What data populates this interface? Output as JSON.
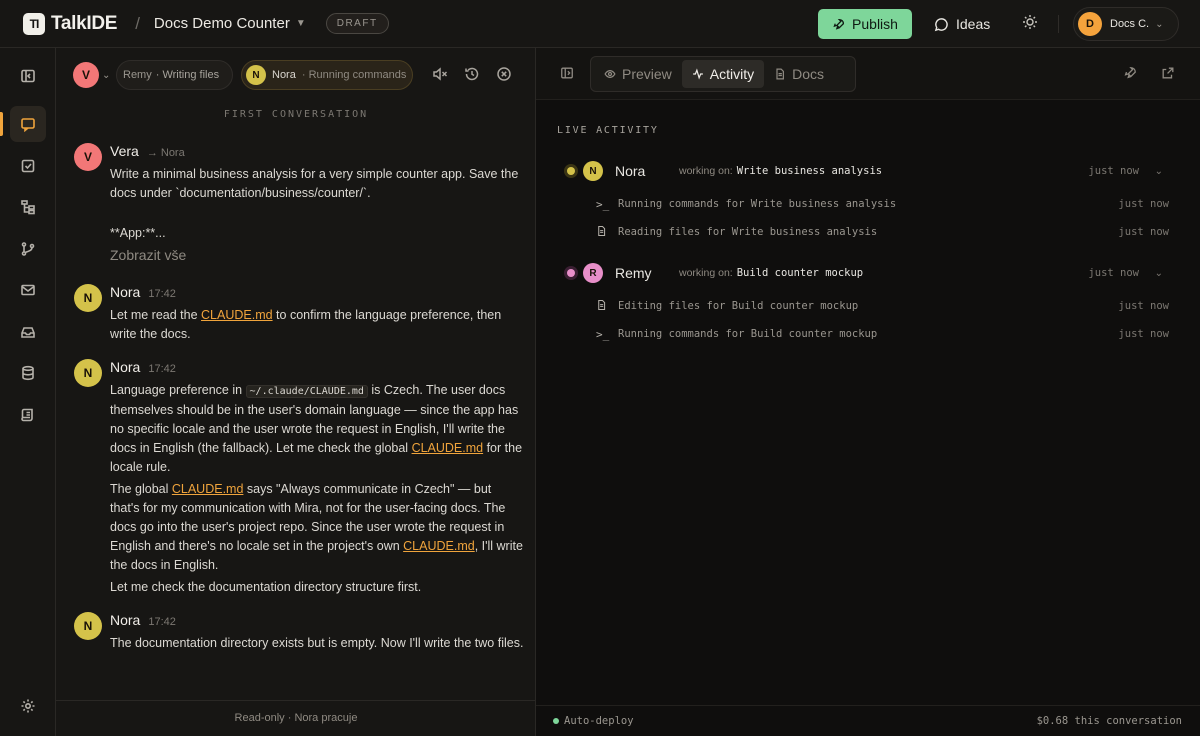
{
  "app": {
    "name": "TalkIDE",
    "logo_mark": "TI",
    "crumb_separator": "/",
    "project_name": "Docs Demo Counter",
    "status_badge": "DRAFT"
  },
  "header": {
    "publish_label": "Publish",
    "ideas_label": "Ideas",
    "user": {
      "initial": "D",
      "name": "Docs C.",
      "color": "#f5a33c"
    }
  },
  "chat": {
    "selected_user_initial": "V",
    "agents": [
      {
        "name": "Remy",
        "status": "· Writing files"
      },
      {
        "name": "Nora",
        "initial": "N",
        "status": "· Running commands"
      }
    ],
    "conversation_label": "FIRST CONVERSATION",
    "messages": [
      {
        "initial": "V",
        "author": "Vera",
        "to": "Nora",
        "text": "Write a minimal business analysis for a very simple counter app. Save the docs under `documentation/business/counter/`.",
        "text2": "**App:**...",
        "show_more": "Zobrazit vše"
      },
      {
        "initial": "N",
        "author": "Nora",
        "time": "17:42",
        "p1_a": "Let me read the ",
        "p1_link": "CLAUDE.md",
        "p1_b": " to confirm the language preference, then write the docs."
      },
      {
        "initial": "N",
        "author": "Nora",
        "time": "17:42",
        "p1_a": "Language preference in ",
        "p1_code": "~/.claude/CLAUDE.md",
        "p1_b": " is Czech. The user docs themselves should be in the user's domain language — since the app has no specific locale and the user wrote the request in English, I'll write the docs in English (the fallback). Let me check the global ",
        "p1_link": "CLAUDE.md",
        "p1_c": " for the locale rule.",
        "p2_a": "The global ",
        "p2_link": "CLAUDE.md",
        "p2_b": " says \"Always communicate in Czech\" — but that's for my communication with Mira, not for the user-facing docs. The docs go into the user's project repo. Since the user wrote the request in English and there's no locale set in the project's own ",
        "p2_link2": "CLAUDE.md",
        "p2_c": ", I'll write the docs in English.",
        "p3": "Let me check the documentation directory structure first."
      },
      {
        "initial": "N",
        "author": "Nora",
        "time": "17:42",
        "text": "The documentation directory exists but is empty. Now I'll write the two files."
      }
    ],
    "footer": "Read-only · Nora pracuje"
  },
  "right": {
    "tabs": [
      "Preview",
      "Activity",
      "Docs"
    ],
    "live_label": "LIVE ACTIVITY",
    "working_on_label": "working on:",
    "activity": [
      {
        "initial": "N",
        "name": "Nora",
        "task": "Write business analysis",
        "when": "just now",
        "color": "#d4c24a",
        "subs": [
          {
            "icon": "terminal-icon",
            "text": "Running commands for Write business analysis",
            "when": "just now"
          },
          {
            "icon": "file-icon",
            "text": "Reading files for Write business analysis",
            "when": "just now"
          }
        ]
      },
      {
        "initial": "R",
        "name": "Remy",
        "task": "Build counter mockup",
        "when": "just now",
        "color": "#e88fc9",
        "subs": [
          {
            "icon": "file-icon",
            "text": "Editing files for Build counter mockup",
            "when": "just now"
          },
          {
            "icon": "terminal-icon",
            "text": "Running commands for Build counter mockup",
            "when": "just now"
          }
        ]
      }
    ],
    "footer": {
      "deploy": "Auto-deploy",
      "cost": "$0.68 this conversation"
    }
  },
  "colors": {
    "accent": "#f0a43c",
    "publish": "#7ed69a",
    "vera": "#f27777",
    "nora": "#d4c24a",
    "remy": "#e88fc9"
  }
}
